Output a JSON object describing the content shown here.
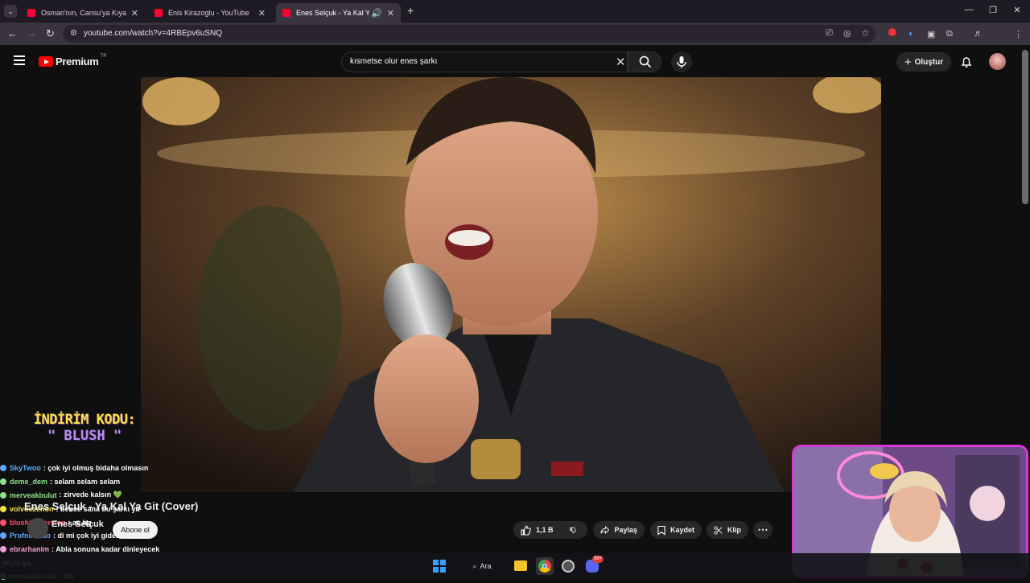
{
  "browser": {
    "tabs": [
      {
        "title": "Osman'nın, Cansu'ya Kıyafet Ay",
        "active": false
      },
      {
        "title": "Enis Kirazoglu - YouTube",
        "active": false
      },
      {
        "title": "Enes Selçuk - Ya Kal Ya Git (",
        "active": true
      }
    ],
    "url": "youtube.com/watch?v=4RBEpv6uSNQ"
  },
  "youtube": {
    "brand": "Premium",
    "region": "TR",
    "search_query": "kısmetse olur enes şarkı",
    "create_label": "Oluştur"
  },
  "video": {
    "title": "Enes Selçuk - Ya Kal Ya Git (Cover)",
    "channel": "Enes Selçuk",
    "subscribe_label": "Abone ol",
    "likes": "1,1 B",
    "share_label": "Paylaş",
    "save_label": "Kaydet",
    "clip_label": "Klip"
  },
  "stream_overlay": {
    "promo_line1": "İNDİRİM KODU:",
    "promo_line2": "\" BLUSH \"",
    "chat": [
      {
        "user": "SkyTwoo",
        "msg": ": çok iyi olmuş bidaha olmasın",
        "color": "#5aa9ff"
      },
      {
        "user": "deme_dem",
        "msg": ": selam selam selam",
        "color": "#8be28b"
      },
      {
        "user": "merveakbulut",
        "msg": ": zirvede kalsın 💚",
        "color": "#8be28b"
      },
      {
        "user": "volvoxzenon",
        "msg": ": bence sana bu şarkı ya",
        "color": "#f5e14a"
      },
      {
        "user": "blushimmersion",
        "msg": ": as hg",
        "color": "#ff4d6d"
      },
      {
        "user": "Profnermuo",
        "msg": ": di mi çok iyi gider",
        "color": "#5aa9ff"
      },
      {
        "user": "ebrarhanim",
        "msg": ": Abla sonuna kadar dinleyecek",
        "color": "#f0a0d8"
      },
      {
        "user": "",
        "msg": "miyiz ya",
        "color": "#ffffff"
      },
      {
        "user": "merveakbulut",
        "msg": ": AS",
        "color": "#8be28b"
      }
    ]
  },
  "taskbar": {
    "search_label": "Ara",
    "badge": "99+"
  }
}
